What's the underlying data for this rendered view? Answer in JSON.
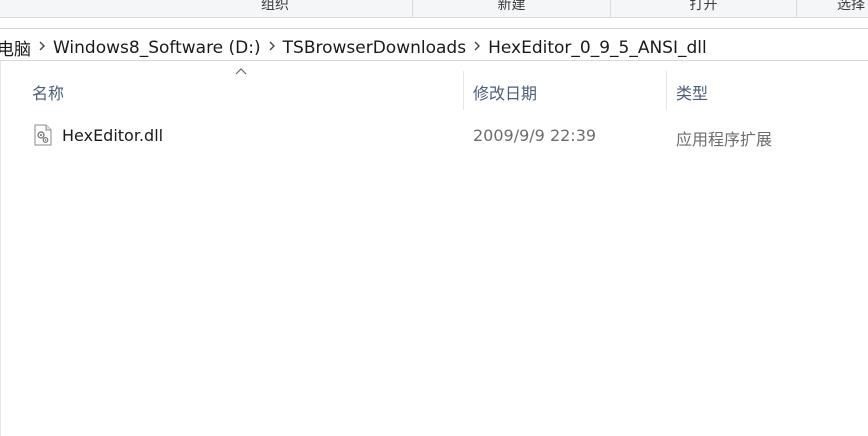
{
  "ribbon": {
    "groups": [
      "组织",
      "新建",
      "打开",
      "选择"
    ]
  },
  "address": {
    "crumbs": [
      "电脑",
      "Windows8_Software (D:)",
      "TSBrowserDownloads",
      "HexEditor_0_9_5_ANSI_dll"
    ],
    "separator": "›"
  },
  "columns": {
    "name": "名称",
    "date": "修改日期",
    "type": "类型"
  },
  "files": [
    {
      "name": "HexEditor.dll",
      "date": "2009/9/9 22:39",
      "type": "应用程序扩展",
      "icon": "dll-file-icon"
    }
  ]
}
